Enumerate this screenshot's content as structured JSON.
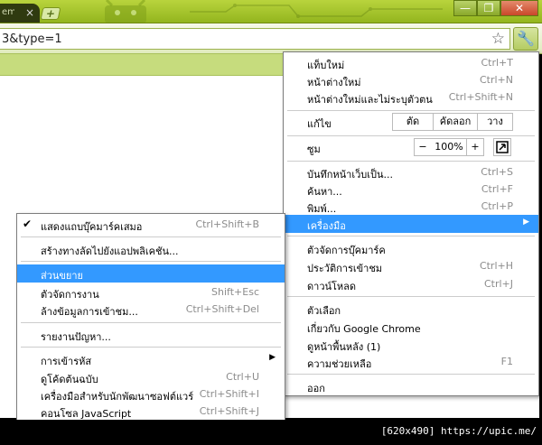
{
  "tab": {
    "title": "em",
    "close": "×",
    "new_tab": "+"
  },
  "window": {
    "minimize": "—",
    "maximize": "❐",
    "close": "✕"
  },
  "address": {
    "url": "3&type=1",
    "star": "☆",
    "wrench": "🔧"
  },
  "main_menu": {
    "group1": [
      {
        "label": "แท็บใหม่",
        "shortcut": "Ctrl+T"
      },
      {
        "label": "หน้าต่างใหม่",
        "shortcut": "Ctrl+N"
      },
      {
        "label": "หน้าต่างใหม่และไม่ระบุตัวตน",
        "shortcut": "Ctrl+Shift+N"
      }
    ],
    "edit": {
      "label": "แก้ไข",
      "cut": "ตัด",
      "copy": "คัดลอก",
      "paste": "วาง"
    },
    "zoom": {
      "label": "ซูม",
      "minus": "−",
      "value": "100%",
      "plus": "+"
    },
    "group2": [
      {
        "label": "บันทึกหน้าเว็บเป็น...",
        "shortcut": "Ctrl+S"
      },
      {
        "label": "ค้นหา...",
        "shortcut": "Ctrl+F"
      },
      {
        "label": "พิมพ์...",
        "shortcut": "Ctrl+P"
      },
      {
        "label": "เครื่องมือ",
        "shortcut": ""
      }
    ],
    "group3": [
      {
        "label": "ตัวจัดการบุ๊คมาร์ค",
        "shortcut": ""
      },
      {
        "label": "ประวัติการเข้าชม",
        "shortcut": "Ctrl+H"
      },
      {
        "label": "ดาวน์โหลด",
        "shortcut": "Ctrl+J"
      }
    ],
    "group4": [
      {
        "label": "ตัวเลือก",
        "shortcut": ""
      },
      {
        "label": "เกี่ยวกับ Google Chrome",
        "shortcut": ""
      },
      {
        "label": "ดูหน้าพื้นหลัง (1)",
        "shortcut": ""
      },
      {
        "label": "ความช่วยเหลือ",
        "shortcut": "F1"
      }
    ],
    "exit": "ออก"
  },
  "tools_menu": {
    "show_bookmarks": {
      "label": "แสดงแถบบุ๊คมาร์คเสมอ",
      "shortcut": "Ctrl+Shift+B",
      "check": "✔"
    },
    "create_shortcut": {
      "label": "สร้างทางลัดไปยังแอปพลิเคชัน..."
    },
    "group": [
      {
        "label": "ส่วนขยาย",
        "shortcut": ""
      },
      {
        "label": "ตัวจัดการงาน",
        "shortcut": "Shift+Esc"
      },
      {
        "label": "ล้างข้อมูลการเข้าชม...",
        "shortcut": "Ctrl+Shift+Del"
      }
    ],
    "report": {
      "label": "รายงานปัญหา..."
    },
    "group2": [
      {
        "label": "การเข้ารหัส",
        "shortcut": ""
      },
      {
        "label": "ดูโค้ดต้นฉบับ",
        "shortcut": "Ctrl+U"
      },
      {
        "label": "เครื่องมือสำหรับนักพัฒนาซอฟต์แวร์",
        "shortcut": "Ctrl+Shift+I"
      },
      {
        "label": "คอนโซล JavaScript",
        "shortcut": "Ctrl+Shift+J"
      }
    ]
  },
  "footer": {
    "watermark": "[620x490] https://upic.me/"
  }
}
